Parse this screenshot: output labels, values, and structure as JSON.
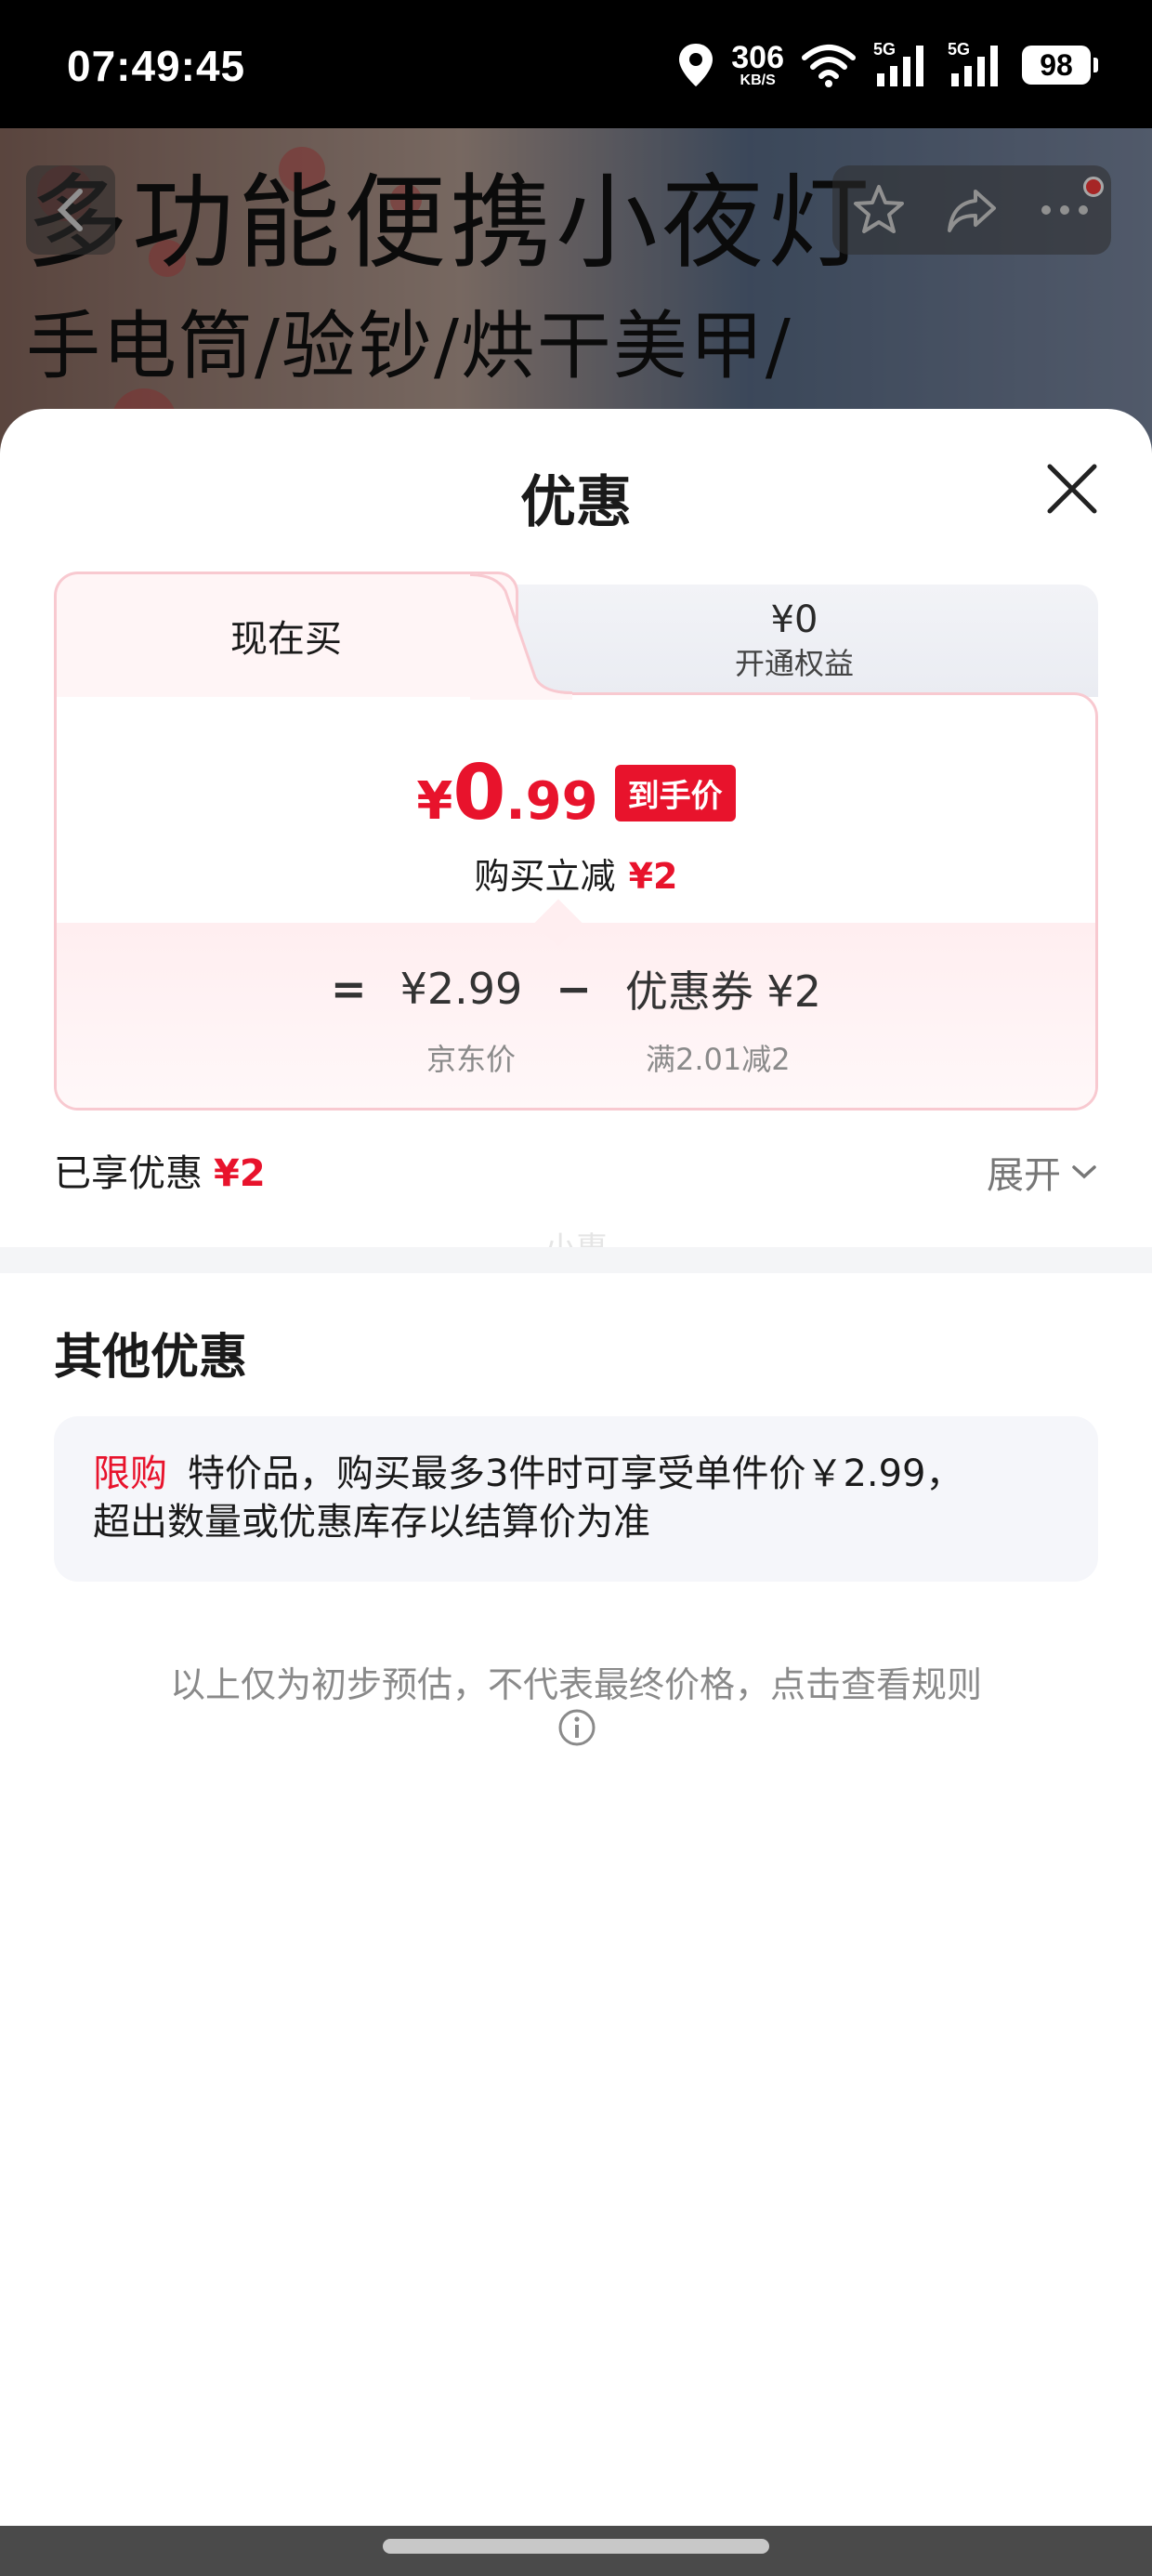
{
  "status_bar": {
    "time": "07:49:45",
    "net_speed": "306",
    "net_unit": "KB/S",
    "sim1": "5G",
    "sim2": "5G",
    "battery": "98"
  },
  "product_background": {
    "title": "多功能便携小夜灯",
    "subtitle": "手电筒/验钞/烘干美甲/"
  },
  "sheet": {
    "title": "优惠",
    "tabs": {
      "now_label": "现在买",
      "other_amount": "¥0",
      "other_label": "开通权益"
    },
    "price": {
      "currency": "¥",
      "integer": "0",
      "decimal": ".99",
      "badge": "到手价"
    },
    "instant_reduce_label": "购买立减",
    "instant_reduce_value": "¥2",
    "breakdown": {
      "eq": "=",
      "jd_price": "¥2.99",
      "minus": "−",
      "coupon": "优惠券 ¥2",
      "jd_price_label": "京东价",
      "coupon_rule": "满2.01减2"
    },
    "enjoyed_label": "已享优惠",
    "enjoyed_value": "¥2",
    "expand_label": "展开",
    "watermark": "小惠",
    "other_title": "其他优惠",
    "other_tag": "限购",
    "other_line1": "特价品，购买最多3件时可享受单件价￥2.99，",
    "other_line2": "超出数量或优惠库存以结算价为准",
    "disclaimer": "以上仅为初步预估，不代表最终价格，点击查看规则"
  },
  "colors": {
    "accent_red": "#e8132c",
    "card_border": "#f8c9d0"
  }
}
